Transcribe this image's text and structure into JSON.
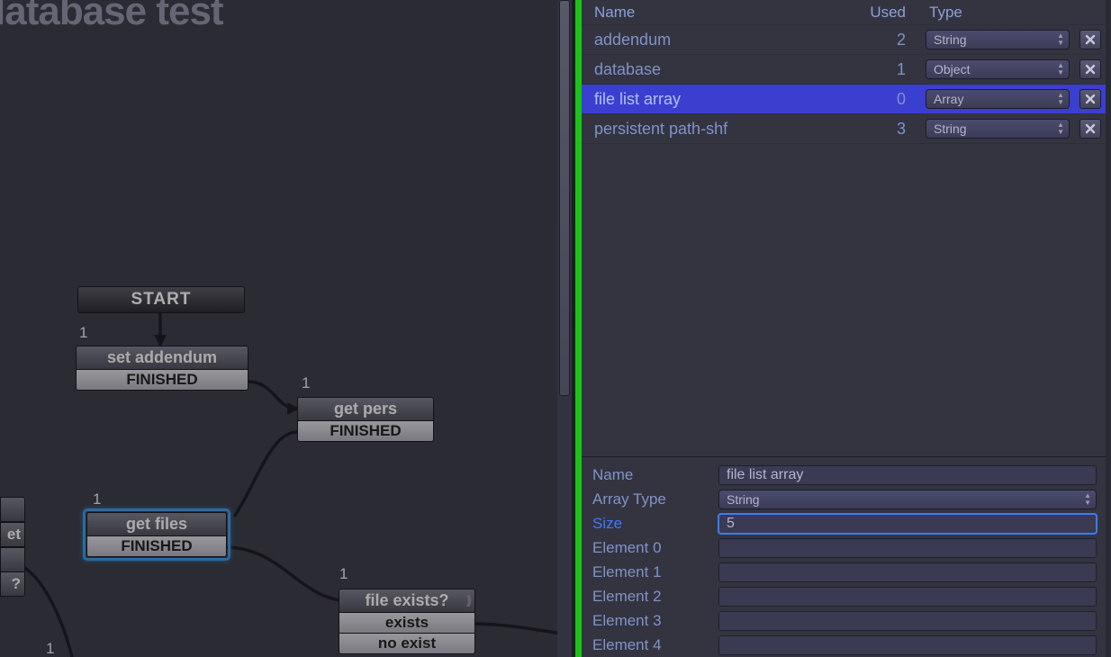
{
  "canvas": {
    "title": "latabase test",
    "start_label": "START",
    "nodes": {
      "set_addendum": {
        "count": "1",
        "title": "set addendum",
        "out": "FINISHED"
      },
      "get_pers": {
        "count": "1",
        "title": "get pers",
        "out": "FINISHED"
      },
      "get_files": {
        "count": "1",
        "title": "get files",
        "out": "FINISHED"
      },
      "file_exists": {
        "count": "1",
        "title": "file exists?",
        "out1": "exists",
        "out2": "no exist"
      },
      "edge": {
        "count": "1",
        "row1": "et",
        "row2": "?"
      }
    }
  },
  "vars": {
    "headers": {
      "name": "Name",
      "used": "Used",
      "type": "Type"
    },
    "rows": [
      {
        "name": "addendum",
        "used": "2",
        "type": "String"
      },
      {
        "name": "database",
        "used": "1",
        "type": "Object"
      },
      {
        "name": "file list array",
        "used": "0",
        "type": "Array"
      },
      {
        "name": "persistent path-shf",
        "used": "3",
        "type": "String"
      }
    ],
    "selected_index": 2
  },
  "detail": {
    "labels": {
      "name": "Name",
      "array_type": "Array Type",
      "size": "Size",
      "elements": [
        "Element 0",
        "Element 1",
        "Element 2",
        "Element 3",
        "Element 4"
      ]
    },
    "name_value": "file list array",
    "array_type_value": "String",
    "size_value": "5",
    "element_values": [
      "",
      "",
      "",
      "",
      ""
    ]
  }
}
